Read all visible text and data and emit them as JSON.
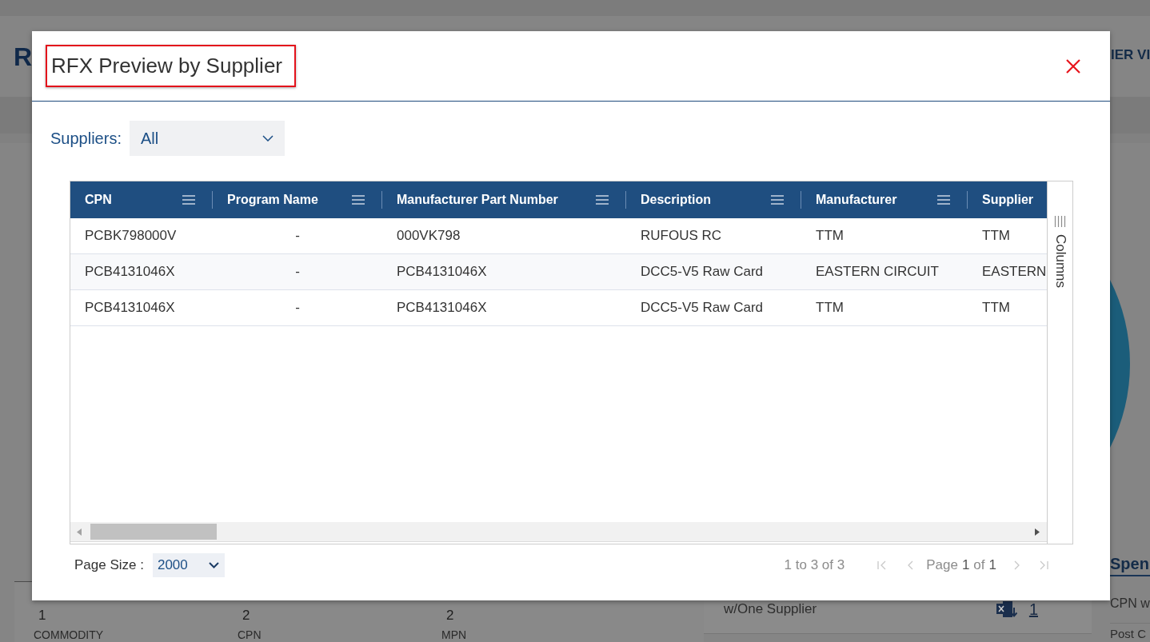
{
  "background": {
    "page_title": "R",
    "nav_item": "IER VI",
    "stats": [
      {
        "value": "1",
        "label": "COMMODITY"
      },
      {
        "value": "2",
        "label": "CPN"
      },
      {
        "value": "2",
        "label": "MPN"
      }
    ],
    "summary_card": {
      "label": "w/One Supplier",
      "count": "1"
    },
    "spend_panel": {
      "title": "Spen",
      "rows": [
        "CPN w",
        "Post C"
      ]
    }
  },
  "dialog": {
    "title": {
      "text": "RFX Preview by Supplier",
      "highlighted": true
    },
    "filter": {
      "label": "Suppliers:",
      "value": "All"
    },
    "table": {
      "columns": [
        {
          "label": "CPN",
          "menu": true
        },
        {
          "label": "Program Name",
          "menu": true
        },
        {
          "label": "Manufacturer Part Number",
          "menu": true
        },
        {
          "label": "Description",
          "menu": true
        },
        {
          "label": "Manufacturer",
          "menu": true
        },
        {
          "label": "Supplier",
          "menu": false
        }
      ],
      "rows": [
        [
          "PCBK798000V",
          "-",
          "000VK798",
          "RUFOUS RC",
          "TTM",
          "TTM"
        ],
        [
          "PCB4131046X",
          "-",
          "PCB4131046X",
          "DCC5-V5 Raw Card",
          "EASTERN CIRCUIT",
          "EASTERN"
        ],
        [
          "PCB4131046X",
          "-",
          "PCB4131046X",
          "DCC5-V5 Raw Card",
          "TTM",
          "TTM"
        ]
      ]
    },
    "side_panel": {
      "label": "Columns"
    },
    "footer": {
      "page_size_label": "Page Size :",
      "page_size": "2000",
      "summary": "1 to 3 of 3",
      "page_label": "Page",
      "page": "1",
      "of_label": "of",
      "page_count": "1",
      "nav": [
        {
          "kind": "first",
          "disabled": true
        },
        {
          "kind": "previous",
          "disabled": true
        },
        {
          "kind": "next",
          "disabled": true
        },
        {
          "kind": "last",
          "disabled": true
        }
      ]
    }
  }
}
